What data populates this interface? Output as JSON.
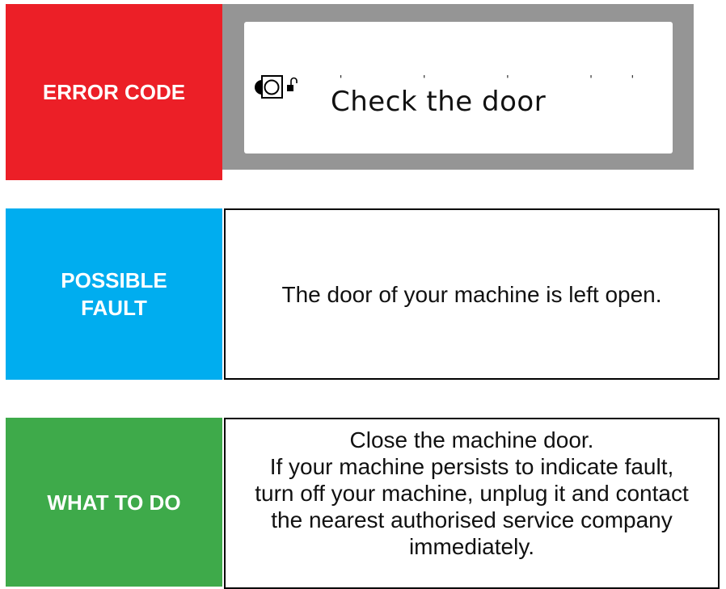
{
  "error_code": {
    "label": "ERROR CODE",
    "display_text": "Check the door",
    "display_icons": [
      "drum-icon",
      "door-lock-icon"
    ]
  },
  "possible_fault": {
    "label_line1": "POSSIBLE",
    "label_line2": "FAULT",
    "text": "The door of your machine is left open."
  },
  "what_to_do": {
    "label": "WHAT TO DO",
    "lines": [
      "Close the machine door.",
      "If your machine persists to indicate fault,",
      "turn off your machine, unplug it and contact",
      "the nearest authorised service company",
      "immediately."
    ]
  },
  "colors": {
    "error_red": "#ec1f27",
    "fault_blue": "#00adef",
    "todo_green": "#3eaa4a",
    "display_frame_gray": "#959595"
  }
}
